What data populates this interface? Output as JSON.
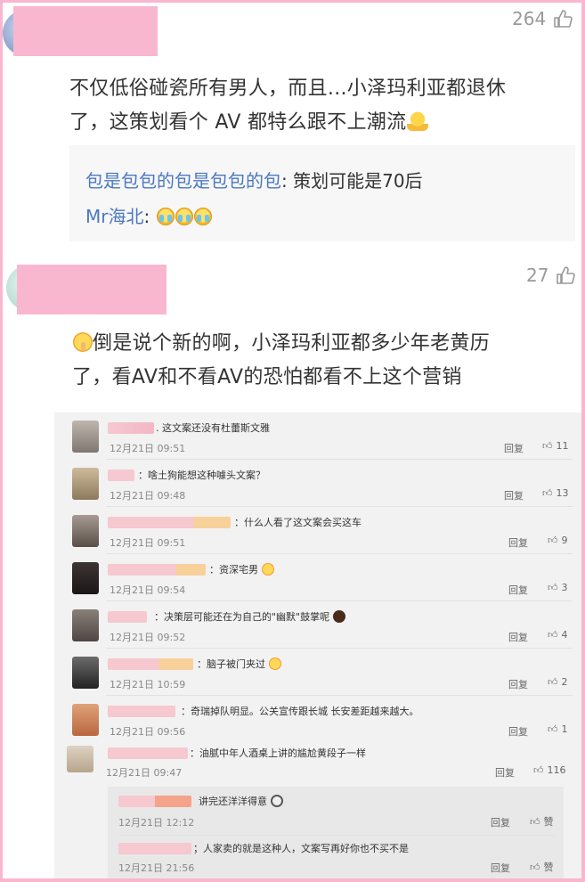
{
  "comments": [
    {
      "likes": "264",
      "text_lines": [
        "不仅低俗碰瓷所有男人，而且...小泽玛利亚都退休",
        "了，这策划看个 AV 都特么跟不上潮流"
      ],
      "emoji": "shrug-emoji",
      "replies": [
        {
          "user": "包是包包的包是包包的包",
          "text": ": 策划可能是70后"
        },
        {
          "user": "Mr海北",
          "text": ":"
        }
      ]
    },
    {
      "likes": "27",
      "text_lines": [
        "倒是说个新的啊，小泽玛利亚都多少年老黄历",
        "了，看AV和不看AV的恐怕都看不上这个营销"
      ],
      "emoji": "shush-emoji"
    }
  ],
  "screenshot": {
    "reply_label": "回复",
    "rows": [
      {
        "text": ". 这文案还没有杜蕾斯文雅",
        "time": "12月21日 09:51",
        "likes": "11"
      },
      {
        "text": "：啥土狗能想这种噱头文案？",
        "time": "12月21日 09:48",
        "likes": "13"
      },
      {
        "text": "：什么人看了这文案会买这车",
        "time": "12月21日 09:51",
        "likes": "9"
      },
      {
        "text": "：资深宅男",
        "time": "12月21日 09:54",
        "likes": "3"
      },
      {
        "text": "：决策层可能还在为自己的\"幽默\"鼓掌呢",
        "time": "12月21日 09:52",
        "likes": "4"
      },
      {
        "text": "：脑子被门夹过",
        "time": "12月21日 10:59",
        "likes": "2"
      },
      {
        "text": "：奇瑞掉队明显。公关宣传跟长城 长安差距越来越大。",
        "time": "12月21日 09:56",
        "likes": "1"
      },
      {
        "text": "：油腻中年人酒桌上讲的尴尬黄段子一样",
        "time": "12月21日 09:47",
        "likes": "116"
      }
    ],
    "subreplies": [
      {
        "text": "讲完还洋洋得意",
        "time": "12月21日 12:12",
        "likes": "赞"
      },
      {
        "text": "；人家卖的就是这种人，文案写再好你也不买不是",
        "time": "12月21日 21:56",
        "likes": "赞"
      }
    ]
  }
}
